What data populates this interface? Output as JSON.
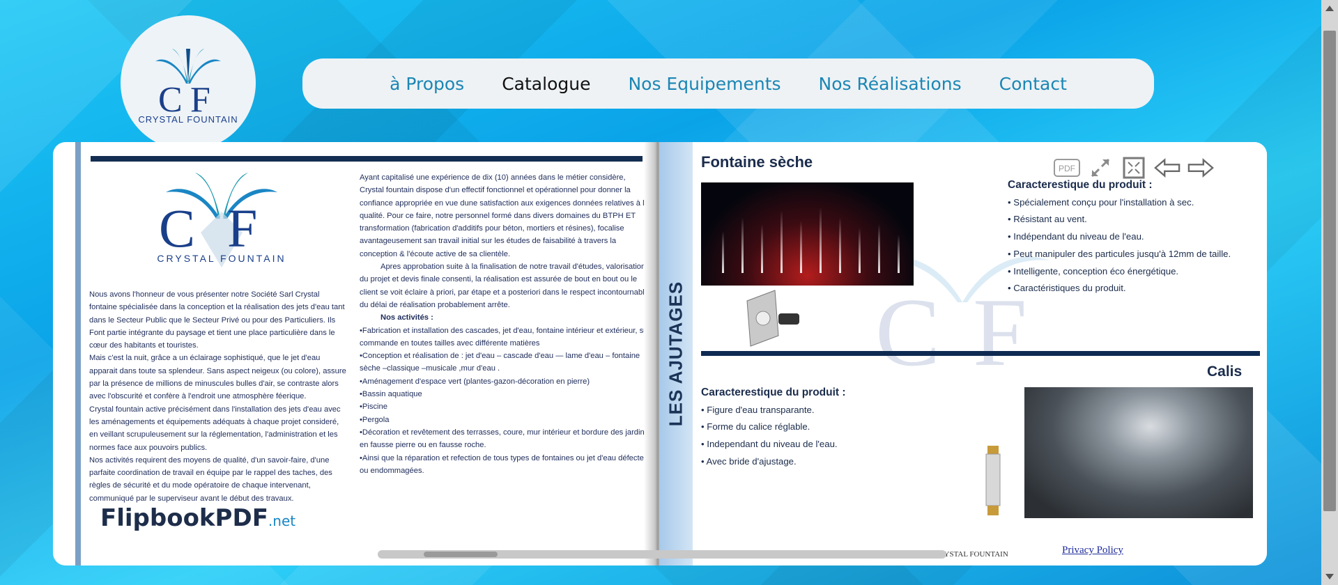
{
  "brand": {
    "logo_text": "CRYSTAL FOUNTAIN"
  },
  "nav": {
    "items": [
      {
        "label": "à Propos",
        "active": false
      },
      {
        "label": "Catalogue",
        "active": true
      },
      {
        "label": "Nos Equipements",
        "active": false
      },
      {
        "label": "Nos Réalisations",
        "active": false
      },
      {
        "label": "Contact",
        "active": false
      }
    ]
  },
  "flipbook": {
    "toolbar": {
      "pdf_label": "PDF",
      "icons": [
        "pdf-icon",
        "expand-icon",
        "fullscreen-icon",
        "prev-arrow-icon",
        "next-arrow-icon"
      ]
    },
    "left_page": {
      "logo_text": "CRYSTAL FOUNTAIN",
      "col1": [
        "Nous avons l'honneur de vous présenter notre Société Sarl Crystal fontaine spécialisée dans la conception et la réalisation des jets d'eau tant dans le Secteur Public que le Secteur Privé ou pour des Particuliers. Ils Font partie intégrante du paysage et tient une place particulière dans le cœur des habitants et touristes.",
        "Mais c'est la nuit, grâce a un éclairage sophistiqué, que le jet d'eau apparait dans toute sa splendeur. Sans aspect neigeux (ou colore), assure par la présence de millions de minuscules bulles d'air, se contraste alors avec l'obscurité et confère à l'endroit une atmosphère féerique.",
        "Crystal fountain active précisément dans l'installation des jets d'eau avec les aménagements et équipements adéquats à chaque projet consideré, en veillant scrupuleusement sur la réglementation, l'administration et les normes face aux pouvoirs publics.",
        "Nos activités requirent des moyens de qualité, d'un savoir-faire, d'une parfaite coordination de travail en équipe par le rappel des taches, des règles de sécurité et du mode opératoire de chaque intervenant, communiqué par le superviseur avant le début des travaux."
      ],
      "col2_intro": "Ayant capitalisé une expérience de dix (10) années dans le métier considère, Crystal fountain dispose d'un effectif fonctionnel et opérationnel pour donner la confiance appropriée en vue dune satisfaction aux exigences données relatives à la qualité. Pour ce faire, notre personnel formé dans divers domaines du BTPH ET transformation (fabrication d'additifs pour béton, mortiers et résines), focalise avantageusement san travail initial sur les études de faisabilité à travers la conception & l'écoute active de sa clientèle.",
      "col2_para2": "Apres approbation suite à la finalisation de notre travail d'études, valorisation du projet et devis finale consenti, la réalisation est assurée de bout en bout ou le client se voit éclaire à priori, par étape et a posteriori dans le respect incontournable du délai de réalisation probablement arrête.",
      "activities_heading": "Nos activités :",
      "activities": [
        "•Fabrication et installation des cascades, jet d'eau, fontaine intérieur et extérieur, sur commande en toutes tailles avec différente matières",
        "•Conception et réalisation de : jet d'eau – cascade d'eau — lame d'eau – fontaine sèche –classique –musicale ,mur d'eau .",
        "•Aménagement d'espace vert (plantes-gazon-décoration en pierre)",
        "•Bassin aquatique",
        "•Piscine",
        "•Pergola",
        "•Décoration et revêtement des terrasses, coure, mur intérieur et bordure des jardins en fausse pierre ou en fausse roche.",
        "•Ainsi que la réparation et refection de tous types de fontaines ou jet d'eau défecteur ou endommagées."
      ],
      "watermark": {
        "brand": "Flipbook",
        "brand2": "PDF",
        "suffix": ".net"
      }
    },
    "right_page": {
      "strip_label": "LES AJUTAGES",
      "product1": {
        "title": "Fontaine sèche",
        "heading": "Caracterestique du produit :",
        "features": [
          "• Spécialement conçu pour l'installation à sec.",
          "• Résistant au vent.",
          "• Indépendant du niveau de l'eau.",
          "• Peut manipuler des particules jusqu'à 12mm de taille.",
          "• Intelligente, conception éco énergétique.",
          "• Caractéristiques du produit."
        ]
      },
      "product2": {
        "title": "Calis",
        "heading": "Caracterestique du produit :",
        "features": [
          "• Figure d'eau transparante.",
          "• Forme du calice réglable.",
          "• Independant du niveau de l'eau.",
          "• Avec bride d'ajustage."
        ]
      },
      "footer": "SARL CRYSTAL FOUNTAIN"
    }
  },
  "privacy_link": "Privacy Policy"
}
